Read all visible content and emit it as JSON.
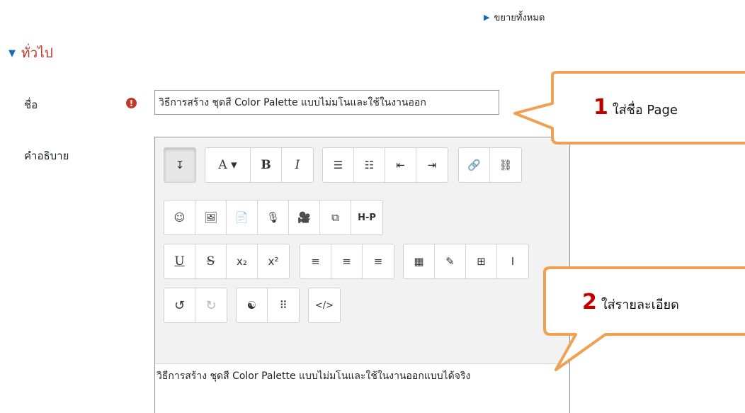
{
  "expand_all": {
    "icon": "triangle-right-icon",
    "label": "ขยายทั้งหมด"
  },
  "section": {
    "icon": "triangle-down-icon",
    "title": "ทั่วไป"
  },
  "fields": {
    "name_label": "ชื่อ",
    "name_required_icon": "!",
    "name_value": "วิธีการสร้าง ชุดสี Color Palette แบบไม่มโนและใช้ในงานออก",
    "description_label": "คำอธิบาย"
  },
  "editor": {
    "row1": {
      "g1": [
        "↧"
      ],
      "g2": [
        "A ▾",
        "B",
        "I"
      ],
      "g3": [
        "☰",
        "☷",
        "⇤",
        "⇥"
      ],
      "g4": [
        "🔗",
        "⛓"
      ]
    },
    "row2": {
      "g1": [
        "☺",
        "🖼",
        "📄",
        "🎙",
        "🎥",
        "⧉",
        "H-P"
      ]
    },
    "row3": {
      "g1": [
        "U",
        "S",
        "x₂",
        "x²"
      ],
      "g2": [
        "≡",
        "≡",
        "≡"
      ],
      "g3": [
        "▦",
        "✎",
        "⊞",
        "I"
      ]
    },
    "row4": {
      "g1": [
        "↺",
        "↻"
      ],
      "g2": [
        "☯",
        "⠿"
      ],
      "g3": [
        "</>"
      ]
    },
    "content": "วิธีการสร้าง ชุดสี Color Palette แบบไม่มโนและใช้ในงานออกแบบได้จริง"
  },
  "callouts": [
    {
      "number": "1",
      "text": "ใส่ชื่อ Page"
    },
    {
      "number": "2",
      "text": "ใส่รายละเอียด"
    }
  ],
  "colors": {
    "callout_border": "#f0a050",
    "section_title": "#c0392b",
    "accent": "#0f6cbf",
    "required": "#c0392b"
  }
}
